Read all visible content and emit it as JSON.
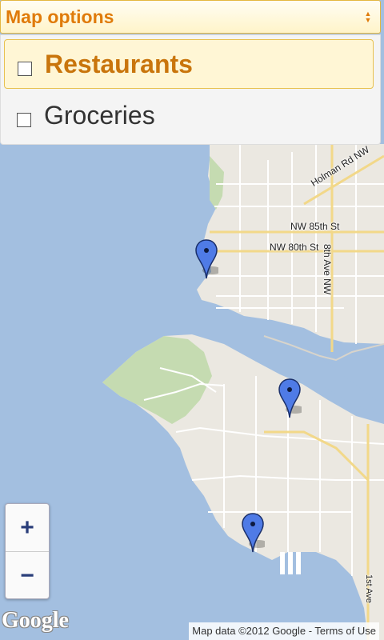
{
  "header": {
    "title": "Map options"
  },
  "options": [
    {
      "label": "Restaurants",
      "checked": false
    },
    {
      "label": "Groceries",
      "checked": false
    }
  ],
  "map": {
    "road_labels": {
      "holman": "Holman Rd NW",
      "nw85": "NW 85th St",
      "nw80": "NW 80th St",
      "ave8": "8th Ave NW",
      "ave1": "1st Ave"
    },
    "markers": [
      "marker-pin",
      "marker-pin",
      "marker-pin"
    ],
    "colors": {
      "water": "#a3bfe0",
      "land": "#ebe8e1",
      "park": "#c5dbb1",
      "pin": "#4f7be6"
    }
  },
  "zoom": {
    "in_label": "+",
    "out_label": "−"
  },
  "branding": {
    "logo": "Google"
  },
  "attribution": {
    "text": "Map data ©2012 Google - Terms of Use"
  }
}
